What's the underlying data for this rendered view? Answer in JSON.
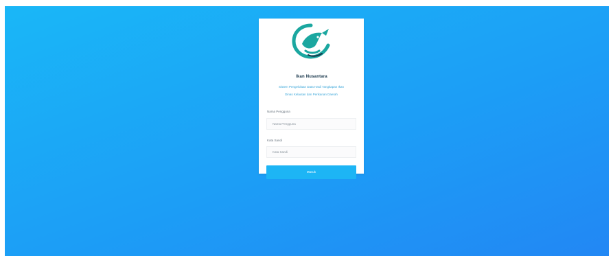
{
  "brand": {
    "logo_name": "fish-logo",
    "name": "Ikan Nusantara",
    "color": "#1ba7a0"
  },
  "login": {
    "subtitle_line1": "Sistem Pengelolaan Data Hasil Tangkapan Ikan",
    "subtitle_line2": "Dinas Kelautan dan Perikanan Daerah",
    "username_label": "Nama Pengguna",
    "username_placeholder": "Nama Pengguna",
    "password_label": "Kata Sandi",
    "password_placeholder": "Kata Sandi",
    "submit_label": "Masuk"
  },
  "colors": {
    "background_start": "#1ab7f7",
    "background_end": "#2287f4",
    "button": "#1db5f5"
  }
}
